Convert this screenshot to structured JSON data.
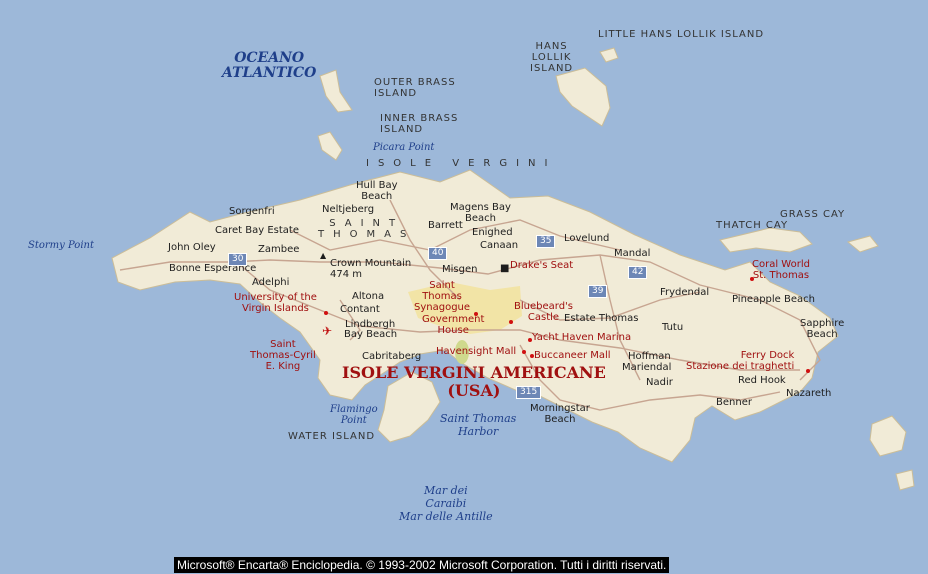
{
  "map": {
    "title": {
      "line1": "ISOLE VERGINI AMERICANE",
      "line2": "(USA)"
    },
    "copyright": "Microsoft® Encarta® Enciclopedia. © 1993-2002 Microsoft Corporation. Tutti i diritti riservati.",
    "colors": {
      "water": "#9db8d9",
      "land": "#f1ebd7",
      "urban": "#f2e4a6",
      "road": "#c7a591",
      "label_red": "#a01010",
      "shield": "#6d87b6"
    },
    "water_labels": {
      "atlantic_1": "OCEANO",
      "atlantic_2": "ATLANTICO",
      "caribbean_1": "Mar dei",
      "caribbean_2": "Caraibi",
      "caribbean_3": "Mar delle Antille",
      "harbor_1": "Saint Thomas",
      "harbor_2": "Harbor",
      "flamingo_1": "Flamingo",
      "flamingo_2": "Point",
      "stormy": "Stormy Point",
      "picara": "Picara Point"
    },
    "island_labels": {
      "little_hans": "LITTLE HANS LOLLIK ISLAND",
      "hans_1": "HANS",
      "hans_2": "LOLLIK",
      "hans_3": "ISLAND",
      "outer_1": "OUTER BRASS",
      "outer_2": "ISLAND",
      "inner_1": "INNER BRASS",
      "inner_2": "ISLAND",
      "isole_vergini": "ISOLE VERGINI",
      "saint_thomas_1": "SAINT",
      "saint_thomas_2": "THOMAS",
      "thatch": "THATCH CAY",
      "grass": "GRASS CAY",
      "water_island": "WATER ISLAND"
    },
    "places": {
      "hull_bay_1": "Hull Bay",
      "hull_bay_2": "Beach",
      "magens_1": "Magens Bay",
      "magens_2": "Beach",
      "sorgenfri": "Sorgenfri",
      "neltjeberg": "Neltjeberg",
      "barrett": "Barrett",
      "enighed": "Enighed",
      "caret_bay": "Caret Bay Estate",
      "john_oley": "John Oley",
      "zambee": "Zambee",
      "canaan": "Canaan",
      "lovelund": "Lovelund",
      "mandal": "Mandal",
      "crown_1": "Crown Mountain",
      "crown_2": "474 m",
      "bonne": "Bonne Esperance",
      "misgen": "Misgen",
      "adelphi": "Adelphi",
      "altona": "Altona",
      "contant": "Contant",
      "lindbergh": "Lindbergh",
      "bay_beach": "Bay Beach",
      "cabritaberg": "Cabritaberg",
      "frydendal": "Frydendal",
      "pineapple": "Pineapple Beach",
      "estate_thomas": "Estate Thomas",
      "tutu": "Tutu",
      "sapphire_1": "Sapphire",
      "sapphire_2": "Beach",
      "hoffman": "Hoffman",
      "mariendal": "Mariendal",
      "nadir": "Nadir",
      "red_hook": "Red Hook",
      "nazareth": "Nazareth",
      "benner": "Benner",
      "morningstar_1": "Morningstar",
      "morningstar_2": "Beach"
    },
    "attractions": {
      "drakes_seat": "Drake's Seat",
      "coral_1": "Coral World",
      "coral_2": "St. Thomas",
      "university_1": "University of the",
      "university_2": "Virgin Islands",
      "synagogue_1": "Saint",
      "synagogue_2": "Thomas",
      "synagogue_3": "Synagogue",
      "government_1": "Government",
      "government_2": "House",
      "bluebeard_1": "Bluebeard's",
      "bluebeard_2": "Castle",
      "yacht_haven": "Yacht Haven Marina",
      "havensight": "Havensight Mall",
      "buccaneer": "Buccaneer Mall",
      "airport_1": "Saint",
      "airport_2": "Thomas-Cyril",
      "airport_3": "E. King",
      "ferry_1": "Ferry Dock",
      "ferry_2": "Stazione dei traghetti"
    },
    "routes": {
      "r30": "30",
      "r35": "35",
      "r40": "40",
      "r42": "42",
      "r39": "39",
      "r315": "315"
    }
  }
}
